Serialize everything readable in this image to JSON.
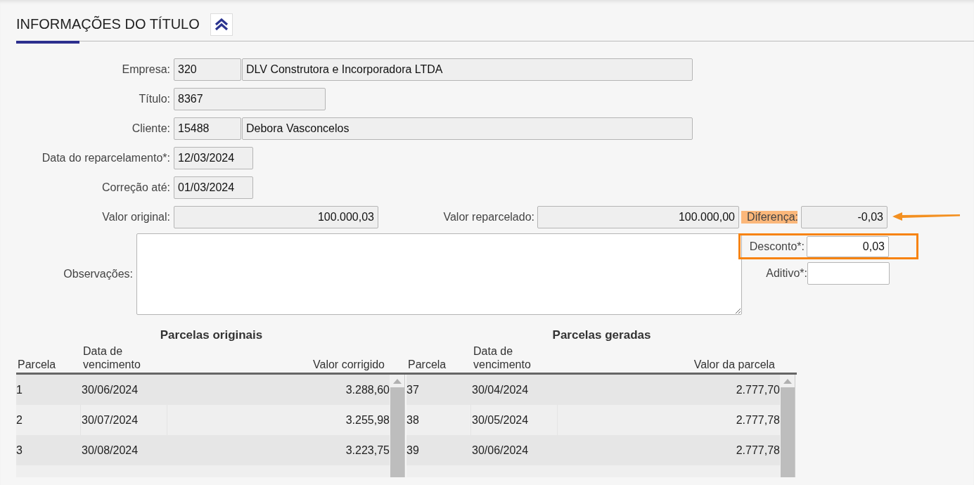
{
  "section": {
    "title": "INFORMAÇÕES DO TÍTULO",
    "expanded": true
  },
  "empresa": {
    "label": "Empresa:",
    "code": "320",
    "name": "DLV Construtora e Incorporadora LTDA"
  },
  "titulo": {
    "label": "Título:",
    "value": "8367"
  },
  "cliente": {
    "label": "Cliente:",
    "code": "15488",
    "name": "Debora Vasconcelos"
  },
  "data_reparcelamento": {
    "label": "Data do reparcelamento*:",
    "value": "12/03/2024"
  },
  "correcao_ate": {
    "label": "Correção até:",
    "value": "01/03/2024"
  },
  "valor_original": {
    "label": "Valor original:",
    "value": "100.000,03"
  },
  "valor_reparcelado": {
    "label": "Valor reparcelado:",
    "value": "100.000,00"
  },
  "diferenca": {
    "label": "Diferença:",
    "value": "-0,03",
    "highlighted": true,
    "arrow": true
  },
  "observacoes": {
    "label": "Observações:"
  },
  "desconto": {
    "label": "Desconto*:",
    "value": "0,03",
    "framed": true
  },
  "aditivo": {
    "label": "Aditivo*:"
  },
  "tables": [
    {
      "title": "Parcelas originais",
      "columns": [
        "Parcela",
        "Data de vencimento",
        "Valor corrigido"
      ],
      "rows": [
        [
          "1",
          "30/06/2024",
          "3.288,60"
        ],
        [
          "2",
          "30/07/2024",
          "3.255,98"
        ],
        [
          "3",
          "30/08/2024",
          "3.223,75"
        ]
      ]
    },
    {
      "title": "Parcelas geradas",
      "columns": [
        "Parcela",
        "Data de vencimento",
        "Valor da parcela"
      ],
      "rows": [
        [
          "37",
          "30/04/2024",
          "2.777,70"
        ],
        [
          "38",
          "30/05/2024",
          "2.777,78"
        ],
        [
          "39",
          "30/06/2024",
          "2.777,78"
        ]
      ]
    }
  ]
}
